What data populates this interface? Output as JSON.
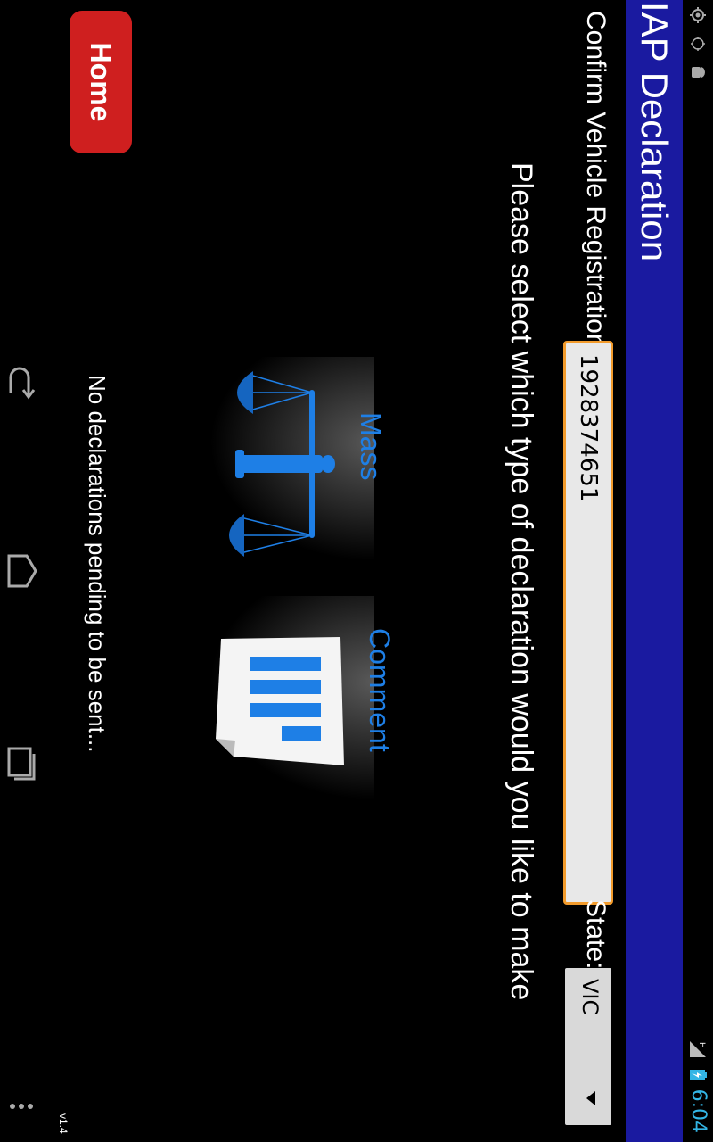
{
  "status_bar": {
    "time": "6:04",
    "left_icons": [
      "location-icon",
      "gps-icon",
      "android-icon"
    ],
    "right_icons": [
      "signal-icon",
      "battery-icon"
    ],
    "network_type": "H",
    "clock_color": "#33b5e5"
  },
  "app": {
    "title": "IAP Declaration",
    "title_bar_color": "#1a1aa0",
    "version": "v1.4"
  },
  "form": {
    "registration_label": "Confirm Vehicle Registration:",
    "registration_value": "1928374651",
    "state_label": "State:",
    "state_value": "VIC"
  },
  "prompt": "Please select which type of declaration would you like to make",
  "declaration_types": [
    {
      "label": "Mass",
      "icon": "scale-icon"
    },
    {
      "label": "Comment",
      "icon": "document-icon"
    }
  ],
  "home_button": {
    "label": "Home",
    "color": "#cf1f1f"
  },
  "pending_message": "No declarations pending to be sent...",
  "nav_bar": {
    "buttons": [
      "back-icon",
      "home-icon",
      "recent-apps-icon"
    ],
    "menu": "overflow-menu-icon"
  },
  "colors": {
    "accent_blue": "#1e7fe6",
    "input_border": "#f29b2c"
  }
}
